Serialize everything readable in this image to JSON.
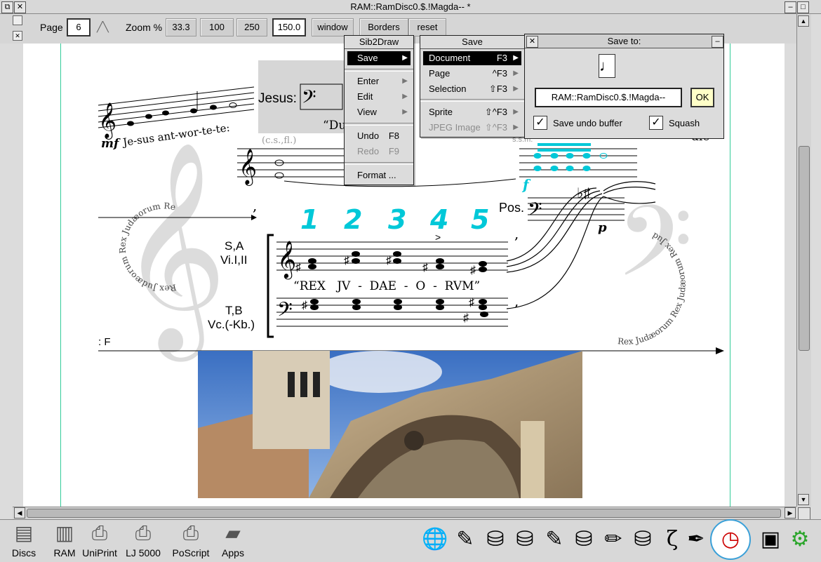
{
  "window": {
    "title": "RAM::RamDisc0.$.!Magda-- *"
  },
  "toolbar": {
    "page_label": "Page",
    "page_value": "6",
    "zoom_label": "Zoom %",
    "zoom_33": "33.3",
    "zoom_100": "100",
    "zoom_250": "250",
    "zoom_value": "150.0",
    "window_btn": "window",
    "borders_btn": "Borders",
    "reset_btn": "reset"
  },
  "main_menu": {
    "title": "Sib2Draw",
    "items": [
      {
        "label": "Save",
        "submenu": true,
        "selected": true
      },
      {
        "label": "Enter",
        "submenu": true
      },
      {
        "label": "Edit",
        "submenu": true
      },
      {
        "label": "View",
        "submenu": true
      },
      {
        "label": "Undo",
        "shortcut": "F8"
      },
      {
        "label": "Redo",
        "shortcut": "F9",
        "disabled": true
      },
      {
        "label": "Format ..."
      }
    ]
  },
  "save_menu": {
    "title": "Save",
    "items": [
      {
        "label": "Document",
        "shortcut": "F3",
        "selected": true
      },
      {
        "label": "Page",
        "shortcut": "^F3"
      },
      {
        "label": "Selection",
        "shortcut": "⇧F3"
      },
      {
        "label": "Sprite",
        "shortcut": "⇧^F3"
      },
      {
        "label": "JPEG Image",
        "shortcut": "⇧^F3",
        "disabled": true
      }
    ]
  },
  "save_dialog": {
    "title": "Save to:",
    "filename": "RAM::RamDisc0.$.!Magda--",
    "ok_label": "OK",
    "undo_label": "Save undo buffer",
    "undo_checked": true,
    "squash_label": "Squash",
    "squash_checked": true
  },
  "score": {
    "dynamic_mf": "mf",
    "lyric_jesus": "Je-sus ant-wor-te-te:",
    "jesus_label": "Jesus:",
    "du_text": "“Du",
    "cs_fl": "(c.s.,fl.)",
    "ss_text": "s.s.m.",
    "die_text": "die",
    "numbers": [
      "1",
      "2",
      "3",
      "4",
      "5"
    ],
    "sa_label": "S,A",
    "vi_label": "Vi.I,II",
    "lyric_rex": "“REX   JV  -  DAE  -  O  -  RVM”",
    "tb_label": "T,B",
    "vc_label": "Vc.(-Kb.)",
    "pos_label": "Pos.",
    "dynamic_f": "f",
    "dynamic_p": "p",
    "f_marker": ": F",
    "circle_text_left": "Rex Judæorum Rex Judæorum Rex",
    "circle_text_right": "Rex Judæorum Rex Judæorum Rex Judæorum"
  },
  "iconbar": {
    "left": [
      {
        "label": "Discs",
        "icon": "discs-icon"
      },
      {
        "label": "RAM",
        "icon": "ram-icon"
      },
      {
        "label": "UniPrint",
        "icon": "printer-icon"
      },
      {
        "label": "LJ 5000",
        "icon": "laserjet-icon"
      },
      {
        "label": "PoScript",
        "icon": "postscript-icon"
      },
      {
        "label": "Apps",
        "icon": "apps-icon"
      }
    ],
    "right_icons": [
      "globe-icon",
      "paint-icon",
      "app-icon",
      "app-icon",
      "paint-icon",
      "app-icon",
      "pencil-icon",
      "app-icon",
      "zeta-icon",
      "draw-icon",
      "clock-icon",
      "display-icon",
      "settings-gear-icon"
    ]
  },
  "colors": {
    "accent": "#00c8d8",
    "window_grey": "#dcdcdc",
    "margin_green": "#33cc99",
    "gear_green": "#2aa52a"
  }
}
